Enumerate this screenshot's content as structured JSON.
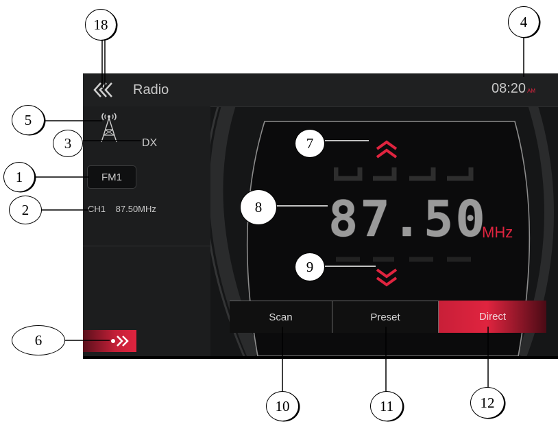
{
  "header": {
    "title": "Radio",
    "time": "08:20",
    "ampm": "AM"
  },
  "station": {
    "dx_label": "DX",
    "band": "FM1",
    "channel": "CH1",
    "channel_freq": "87.50MHz"
  },
  "tuner": {
    "frequency": "87.50",
    "unit": "MHz"
  },
  "tabs": [
    {
      "label": "Scan"
    },
    {
      "label": "Preset"
    },
    {
      "label": "Direct"
    }
  ],
  "callouts": [
    "1",
    "2",
    "3",
    "4",
    "5",
    "6",
    "7",
    "8",
    "9",
    "10",
    "11",
    "12",
    "18"
  ],
  "colors": {
    "accent": "#e0243f",
    "background": "#151617",
    "text": "#c8c8c8"
  },
  "icons": {
    "back": "double-chevron-left-icon",
    "antenna": "antenna-tower-icon",
    "up": "chevron-up-icon",
    "down": "chevron-down-icon",
    "menu": "arrow-right-icon"
  }
}
